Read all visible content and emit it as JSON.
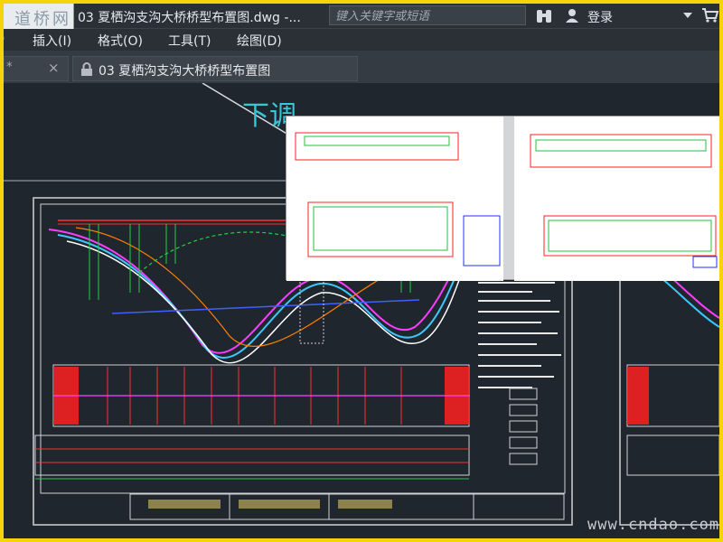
{
  "window": {
    "logo_text": "道桥网",
    "title": "03 夏栖沟支沟大桥桥型布置图.dwg -...",
    "search_placeholder": "键入关键字或短语",
    "login_label": "登录"
  },
  "menu": {
    "items": [
      "插入(I)",
      "格式(O)",
      "工具(T)",
      "绘图(D)"
    ]
  },
  "tabs": [
    {
      "label": "",
      "close": "×"
    },
    {
      "label": "03 夏栖沟支沟大桥桥型布置图"
    }
  ],
  "drawing": {
    "cyan_text": "下调",
    "watermark": "www.cndao.com"
  },
  "colors": {
    "accent": "#f5d40a",
    "ui_bg": "#2b3037",
    "canvas_bg": "#1f262e"
  }
}
